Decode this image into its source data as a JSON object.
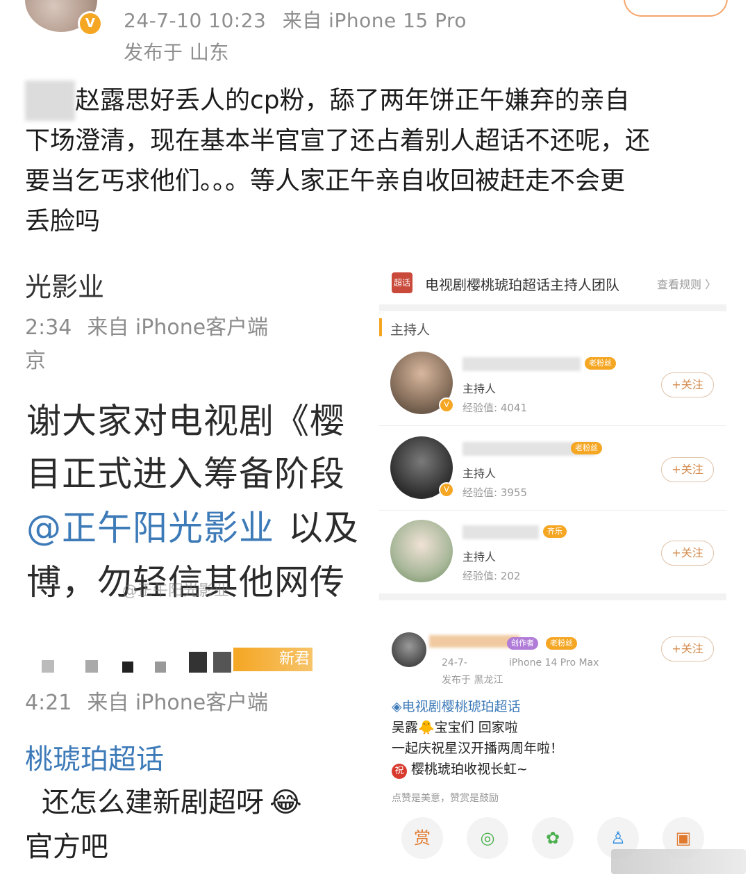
{
  "main_post": {
    "timestamp": "24-7-10 10:23",
    "source": "来自 iPhone 15 Pro",
    "location": "发布于 山东",
    "text_lines": [
      "赵露思好丢人的cp粉，舔了两年饼正午嫌弃的亲自",
      "下场澄清，现在基本半官宣了还占着别人超话不还呢，还",
      "要当乞丐求他们。。。等人家正午亲自收回被赶走不会更",
      "丢脸吗"
    ],
    "verified_badge": "V"
  },
  "left_screenshot": {
    "account_partial": "光影业",
    "time1": "2:34",
    "source1": "来自 iPhone客户端",
    "location1": "京",
    "body_lines": [
      "谢大家对电视剧《樱",
      "目正式进入筹备阶段",
      "以及",
      "博，勿轻信其他网传"
    ],
    "mention": "@正午阳光影业",
    "watermark": "@正午阳光影业",
    "tag2": "新君",
    "time2": "4:21",
    "source2": "来自 iPhone客户端",
    "topic_partial": "桃琥珀超话",
    "reply_line": "还怎么建新剧超呀",
    "reply_emoji": "😂",
    "last_line": "官方吧"
  },
  "right_screenshot": {
    "header_logo": "超话",
    "header_title": "电视剧樱桃琥珀超话主持人团队",
    "header_link": "查看规则 〉",
    "section": "主持人",
    "hosts": [
      {
        "role": "主持人",
        "exp_label": "经验值:",
        "exp": "4041",
        "tag": "老粉丝",
        "tag_color": "#f5a623",
        "follow": "+关注"
      },
      {
        "role": "主持人",
        "exp_label": "经验值:",
        "exp": "3955",
        "tag": "老粉丝",
        "tag_color": "#f5a623",
        "follow": "+关注"
      },
      {
        "role": "主持人",
        "exp_label": "经验值:",
        "exp": "202",
        "tag": "齐乐",
        "tag_color": "#f5a623",
        "follow": "+关注"
      }
    ],
    "post": {
      "badge1": "创作者",
      "badge2": "老粉丝",
      "date": "24-7-",
      "device": "iPhone 14 Pro Max",
      "location": "发布于 黑龙江",
      "follow": "+关注",
      "topic": "电视剧樱桃琥珀超话",
      "line1": "吴露🐥宝宝们 回家啦",
      "line2": "一起庆祝星汉开播两周年啦！",
      "line3": "樱桃琥珀收视长虹~",
      "line3_badge": "祝",
      "reward_hint": "点赞是美意，赞赏是鼓励",
      "actions": [
        {
          "icon": "reward-icon",
          "glyph": "赏"
        },
        {
          "icon": "wechat-icon",
          "glyph": "◎"
        },
        {
          "icon": "moments-icon",
          "glyph": "✿"
        },
        {
          "icon": "qq-icon",
          "glyph": "♙"
        },
        {
          "icon": "image-icon",
          "glyph": "▣"
        }
      ]
    }
  },
  "colors": {
    "accent": "#f5a623",
    "link": "#3d7ab8",
    "follow": "#d58b4f"
  }
}
